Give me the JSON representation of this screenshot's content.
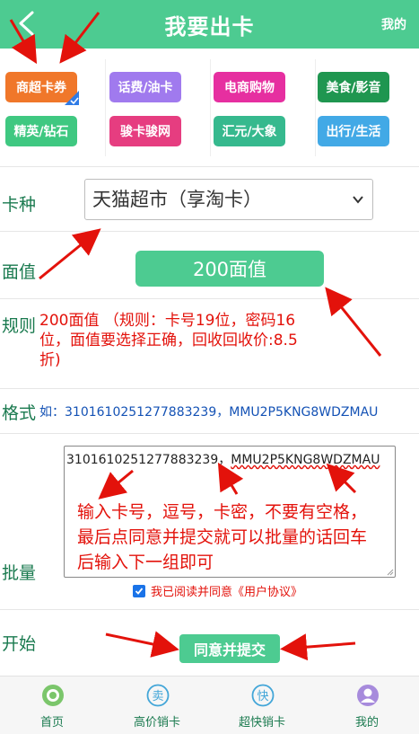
{
  "header": {
    "title": "我要出卡",
    "right_link": "我的"
  },
  "categories": [
    {
      "label": "商超卡券",
      "color": "#f0772a",
      "selected": true
    },
    {
      "label": "话费/油卡",
      "color": "#a07aee"
    },
    {
      "label": "电商购物",
      "color": "#e62fa0"
    },
    {
      "label": "美食/影音",
      "color": "#1f9650"
    },
    {
      "label": "精英/钻石",
      "color": "#3fc881"
    },
    {
      "label": "骏卡骏网",
      "color": "#e63d80"
    },
    {
      "label": "汇元/大象",
      "color": "#36b98e"
    },
    {
      "label": "出行/生活",
      "color": "#42a9e6"
    }
  ],
  "form": {
    "card_type_label": "卡种",
    "card_type_value": "天猫超市（享淘卡）",
    "face_label": "面值",
    "face_value": "200面值",
    "rule_label": "规则",
    "rule_text": "200面值 （规则：卡号19位，密码16位，面值要选择正确，回收回收价:8.5折)",
    "format_label": "格式",
    "format_text": "如：3101610251277883239，MMU2P5KNG8WDZMAU",
    "batch_label": "批量",
    "batch_value_number": "3101610251277883239，",
    "batch_value_secret": "MMU2P5KNG8WDZMAU",
    "batch_hint": "输入卡号，逗号，卡密，不要有空格，最后点同意并提交就可以批量的话回车后输入下一组即可",
    "agree_prefix": "我已阅读并同意",
    "agree_link": "《用户协议》",
    "start_label": "开始",
    "submit_label": "同意并提交"
  },
  "nav": [
    {
      "label": "首页",
      "icon": "home-icon",
      "color": "#7bc66b"
    },
    {
      "label": "高价销卡",
      "icon": "sell-icon",
      "color": "#43a6d8"
    },
    {
      "label": "超快销卡",
      "icon": "fast-icon",
      "color": "#43a6d8"
    },
    {
      "label": "我的",
      "icon": "user-icon",
      "color": "#a78bdc"
    }
  ],
  "colors": {
    "accent": "#4dcb91",
    "annotation": "#e3120b"
  }
}
